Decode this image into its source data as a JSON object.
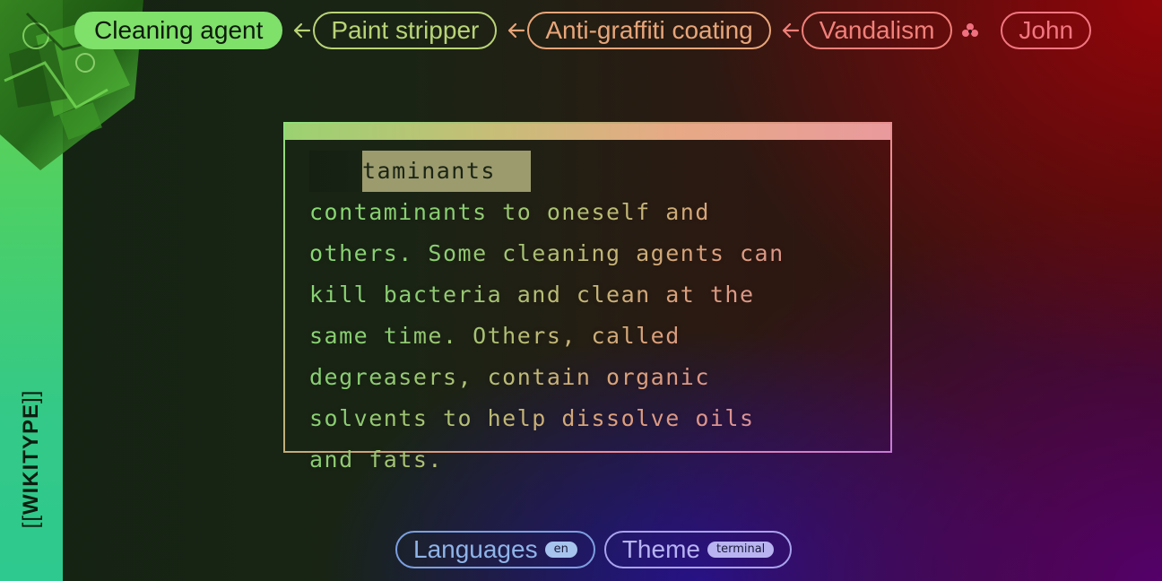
{
  "brand": {
    "open": "[[",
    "name": "WIKITYPE",
    "close": "]]"
  },
  "breadcrumb": [
    {
      "label": "Cleaning agent",
      "active": true
    },
    {
      "label": "Paint stripper",
      "active": false
    },
    {
      "label": "Anti-graffiti coating",
      "active": false
    },
    {
      "label": "Vandalism",
      "active": false
    },
    {
      "label": "John",
      "active": false
    }
  ],
  "icons": {
    "back_arrow": "arrow-left-icon",
    "link": "clover-icon"
  },
  "article": {
    "selected": "taminants ",
    "lines": [
      "contaminants to oneself and",
      "others. Some cleaning agents can",
      "kill bacteria and clean at the",
      "same time. Others, called",
      "degreasers, contain organic",
      "solvents to help dissolve oils",
      "and fats."
    ]
  },
  "controls": {
    "languages_label": "Languages",
    "languages_value": "en",
    "theme_label": "Theme",
    "theme_value": "terminal"
  },
  "colors": {
    "sidebar": "#4cd066",
    "active_chip": "#7fe06a",
    "highlight": "#a6a676"
  }
}
